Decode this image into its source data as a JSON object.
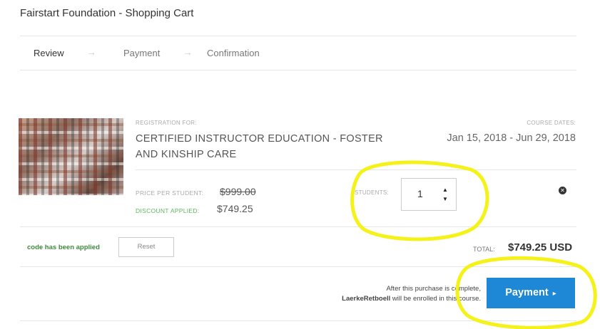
{
  "header": {
    "title": "Fairstart Foundation - Shopping Cart"
  },
  "steps": [
    {
      "label": "Review"
    },
    {
      "label": "Payment"
    },
    {
      "label": "Confirmation"
    }
  ],
  "step_arrow": "→",
  "course": {
    "registration_label": "REGISTRATION FOR:",
    "title_line1": "CERTIFIED INSTRUCTOR EDUCATION - FOSTER",
    "title_line2": "AND KINSHIP CARE",
    "dates_label": "COURSE DATES:",
    "dates": "Jan 15, 2018 - Jun 29, 2018"
  },
  "pricing": {
    "price_label": "PRICE PER STUDENT:",
    "price_original": "$999.00",
    "discount_label": "DISCOUNT APPLIED:",
    "price_discounted": "$749.25"
  },
  "students": {
    "label": "STUDENTS:",
    "quantity": "1"
  },
  "coupon": {
    "applied_text": "code has been applied",
    "reset_label": "Reset"
  },
  "total": {
    "label": "TOTAL:",
    "value": "$749.25 USD"
  },
  "notice": {
    "line1": "After this purchase is complete,",
    "user": "LaerkeRetboell",
    "line2_suffix": " will be enrolled in this course."
  },
  "payment_button": {
    "label": "Payment",
    "chevron": "▸"
  },
  "colors": {
    "accent": "#1e88d6",
    "discount_green": "#5cb85c",
    "annotation_highlight": "#f5f21a"
  }
}
